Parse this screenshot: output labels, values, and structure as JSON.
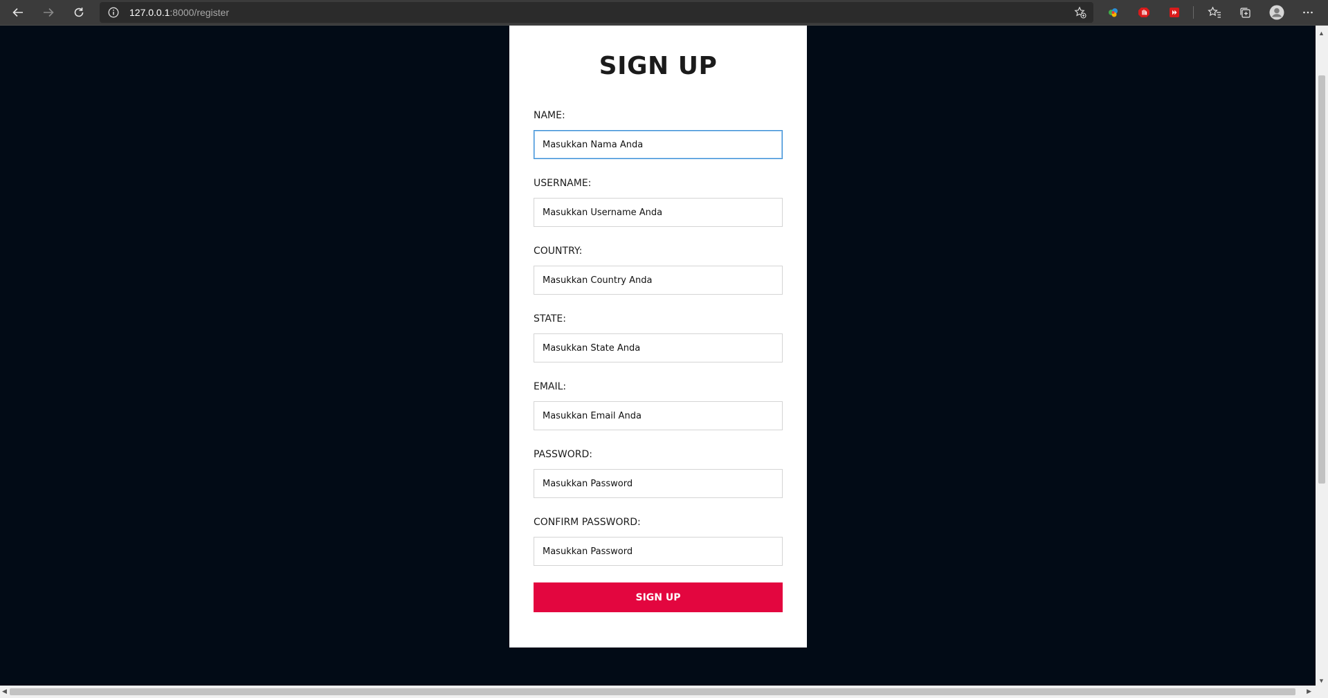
{
  "browser": {
    "url_host": "127.0.0.1",
    "url_rest": ":8000/register"
  },
  "form": {
    "title": "SIGN UP",
    "fields": [
      {
        "label": "NAME:",
        "placeholder": "Masukkan Nama Anda"
      },
      {
        "label": "USERNAME:",
        "placeholder": "Masukkan Username Anda"
      },
      {
        "label": "COUNTRY:",
        "placeholder": "Masukkan Country Anda"
      },
      {
        "label": "STATE:",
        "placeholder": "Masukkan State Anda"
      },
      {
        "label": "EMAIL:",
        "placeholder": "Masukkan Email Anda"
      },
      {
        "label": "PASSWORD:",
        "placeholder": "Masukkan Password"
      },
      {
        "label": "CONFIRM PASSWORD:",
        "placeholder": "Masukkan Password"
      }
    ],
    "submit_label": "SIGN UP"
  },
  "colors": {
    "page_background": "#020b16",
    "submit_button": "#e3063f",
    "focus_border": "#3b8fd6"
  }
}
